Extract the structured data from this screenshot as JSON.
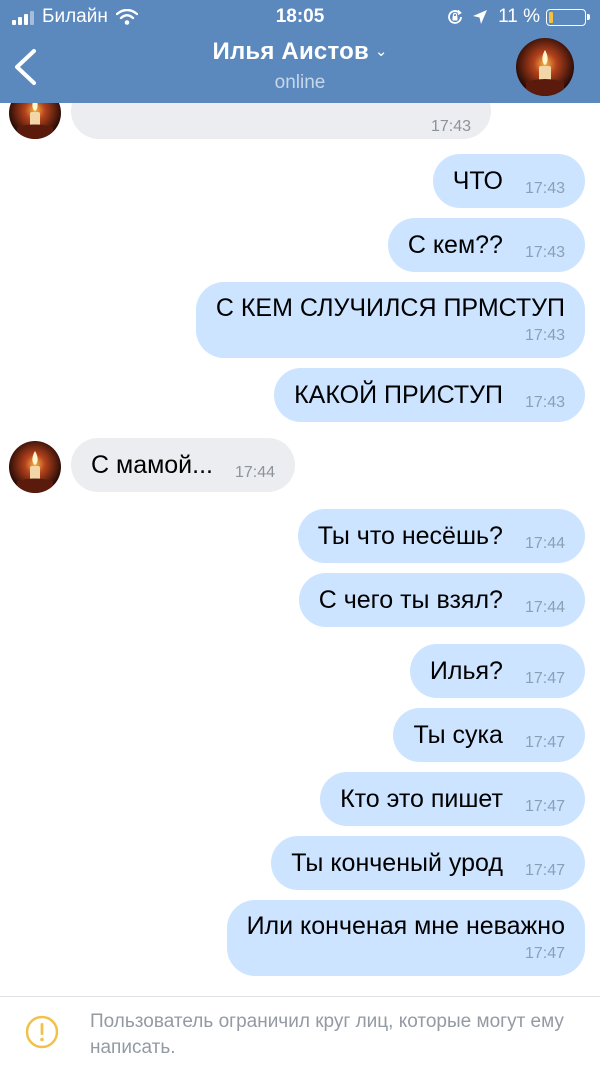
{
  "status_bar": {
    "carrier": "Билайн",
    "time": "18:05",
    "battery": "11 %",
    "battery_level": 0.11
  },
  "header": {
    "title": "Илья Аистов",
    "subtitle": "online"
  },
  "messages": [
    {
      "dir": "in",
      "text": "",
      "time": "17:43"
    },
    {
      "dir": "out",
      "text": "ЧТО",
      "time": "17:43"
    },
    {
      "dir": "out",
      "text": "С кем??",
      "time": "17:43"
    },
    {
      "dir": "out",
      "text": "С КЕМ СЛУЧИЛСЯ ПРМСТУП",
      "time": "17:43"
    },
    {
      "dir": "out",
      "text": "КАКОЙ ПРИСТУП",
      "time": "17:43"
    },
    {
      "dir": "in",
      "text": "С мамой...",
      "time": "17:44"
    },
    {
      "dir": "out",
      "text": "Ты что несёшь?",
      "time": "17:44"
    },
    {
      "dir": "out",
      "text": "С чего ты взял?",
      "time": "17:44"
    },
    {
      "dir": "out",
      "text": "Илья?",
      "time": "17:47"
    },
    {
      "dir": "out",
      "text": "Ты сука",
      "time": "17:47"
    },
    {
      "dir": "out",
      "text": "Кто это пишет",
      "time": "17:47"
    },
    {
      "dir": "out",
      "text": "Ты конченый урод",
      "time": "17:47"
    },
    {
      "dir": "out",
      "text": "Или конченая мне неважно",
      "time": "17:47"
    }
  ],
  "footer": {
    "notice": "Пользователь ограничил круг лиц, которые могут ему написать."
  },
  "colors": {
    "header": "#5b88bd",
    "outgoing_bubble": "#cce4ff",
    "incoming_bubble": "#ebedf0",
    "warning": "#f2c14b"
  }
}
